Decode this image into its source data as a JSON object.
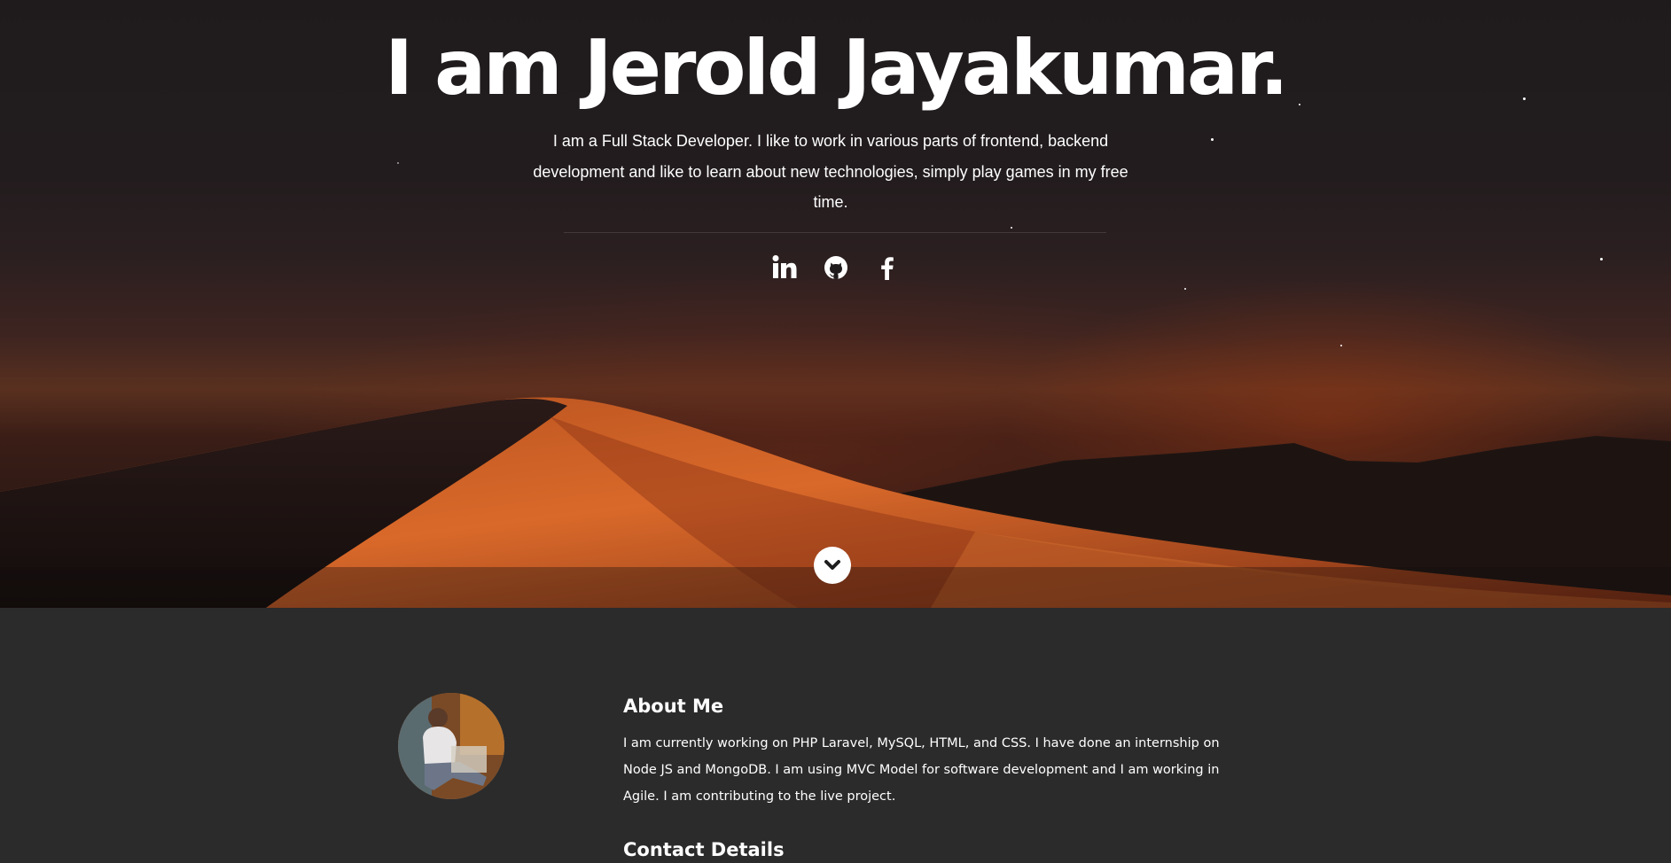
{
  "hero": {
    "title": "I am Jerold Jayakumar.",
    "description": "I am a Full Stack Developer. I like to work in various parts of frontend, backend development and like to learn about new technologies, simply play games in my free time.",
    "social": [
      {
        "icon": "linkedin-icon"
      },
      {
        "icon": "github-icon"
      },
      {
        "icon": "facebook-icon"
      }
    ],
    "scroll_icon": "chevron-down-icon"
  },
  "about": {
    "heading": "About Me",
    "text": "I am currently working on PHP Laravel, MySQL, HTML, and CSS. I have done an internship on Node JS and MongoDB. I am using MVC Model for software development and I am working in Agile. I am contributing to the live project.",
    "contact_heading": "Contact Details"
  },
  "colors": {
    "background": "#2b2b2b",
    "text": "#ffffff",
    "dune_glow": "#c4531d"
  }
}
